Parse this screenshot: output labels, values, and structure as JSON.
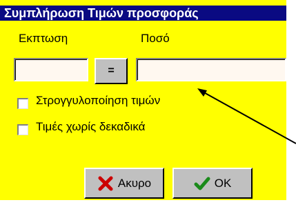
{
  "dialog": {
    "title": "Συμπλήρωση Τιμών προσφοράς",
    "discount_label": "Εκπτωση",
    "amount_label": "Ποσό",
    "discount_value": "",
    "amount_value": "",
    "equals_label": "=",
    "round_prices_label": "Στρογγυλοποίηση τιμών",
    "no_decimals_label": "Τιμές χωρίς δεκαδικά",
    "round_prices_checked": false,
    "no_decimals_checked": false,
    "cancel_label": "Ακυρο",
    "ok_label": "OK"
  },
  "icons": {
    "cancel": "red-x-icon",
    "ok": "green-check-icon"
  },
  "colors": {
    "dialog_background": "#ffff00",
    "titlebar": "#0a0a82",
    "cancel_icon": "#cc0000",
    "ok_icon": "#1a8a1a"
  }
}
